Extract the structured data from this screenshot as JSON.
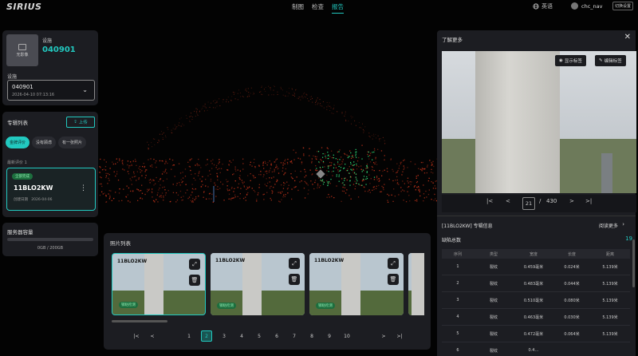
{
  "app": {
    "logo": "SIRIUS"
  },
  "nav": {
    "items": [
      "制图",
      "检查",
      "报告"
    ],
    "active_index": 2
  },
  "header": {
    "lang_icon": "globe-icon",
    "lang_label": "英语",
    "username": "chc_nav",
    "user_button": "切换设置"
  },
  "device": {
    "thumb_label": "无影像",
    "label": "设施",
    "id": "040901",
    "select_label": "设施",
    "select_value": "040901",
    "select_date": "2026-04-10 07:13:16"
  },
  "projects": {
    "title": "专辑列表",
    "upload_label": "上传",
    "tabs": [
      "金牌评价",
      "没有顾虑",
      "有一张照片"
    ],
    "active_tab": 0,
    "recent_label": "最新评价 1",
    "item": {
      "badge": "全部完成",
      "name": "11BLO2KW",
      "meta_label": "创建日期",
      "meta_date": "2026-04-06"
    }
  },
  "storage": {
    "title": "服务器容量",
    "value": "0GB / 200GB",
    "used_fraction": 0.0
  },
  "photo_list": {
    "title": "照片列表",
    "photos": [
      {
        "label": "11BLO2KW",
        "badge": "钢粘检测",
        "selected": true
      },
      {
        "label": "11BLO2KW",
        "badge": "钢粘检测",
        "selected": false
      },
      {
        "label": "11BLO2KW",
        "badge": "钢粘检测",
        "selected": false
      },
      {
        "label": "",
        "badge": "",
        "selected": false
      }
    ],
    "pages": [
      "1",
      "2",
      "3",
      "4",
      "5",
      "6",
      "7",
      "8",
      "9",
      "10"
    ],
    "current_page": "2",
    "first_glyph": "|<",
    "prev_glyph": "<",
    "next_glyph": ">",
    "last_glyph": ">|"
  },
  "detail": {
    "title": "了解更多",
    "close_glyph": "✕",
    "show_marks_label": "显示标签",
    "edit_marks_label": "编辑标签",
    "current_index": "21",
    "total": "430",
    "separator": "/",
    "first_glyph": "|<",
    "prev_glyph": "<",
    "next_glyph": ">",
    "last_glyph": ">|",
    "project_info": "[11BLO2KW] 专辑信息",
    "read_more": "阅读更多",
    "chevron": "›",
    "count_label": "缺陷总数",
    "count": "19",
    "table": {
      "headers": [
        "序列",
        "类型",
        "宽度",
        "长度",
        "距离"
      ],
      "rows": [
        [
          "1",
          "裂纹",
          "0.459毫米",
          "0.024米",
          "5.139米"
        ],
        [
          "2",
          "裂纹",
          "0.483毫米",
          "0.044米",
          "5.139米"
        ],
        [
          "3",
          "裂纹",
          "0.510毫米",
          "0.080米",
          "5.139米"
        ],
        [
          "4",
          "裂纹",
          "0.463毫米",
          "0.030米",
          "5.139米"
        ],
        [
          "5",
          "裂纹",
          "0.472毫米",
          "0.064米",
          "5.139米"
        ],
        [
          "6",
          "裂纹",
          "0.4…",
          "",
          ""
        ]
      ]
    }
  },
  "colors": {
    "accent": "#22c9c0",
    "panel": "#1c1d22",
    "background": "#030303",
    "cloud_red": "#c2331a",
    "cloud_green": "#2fe07a"
  }
}
